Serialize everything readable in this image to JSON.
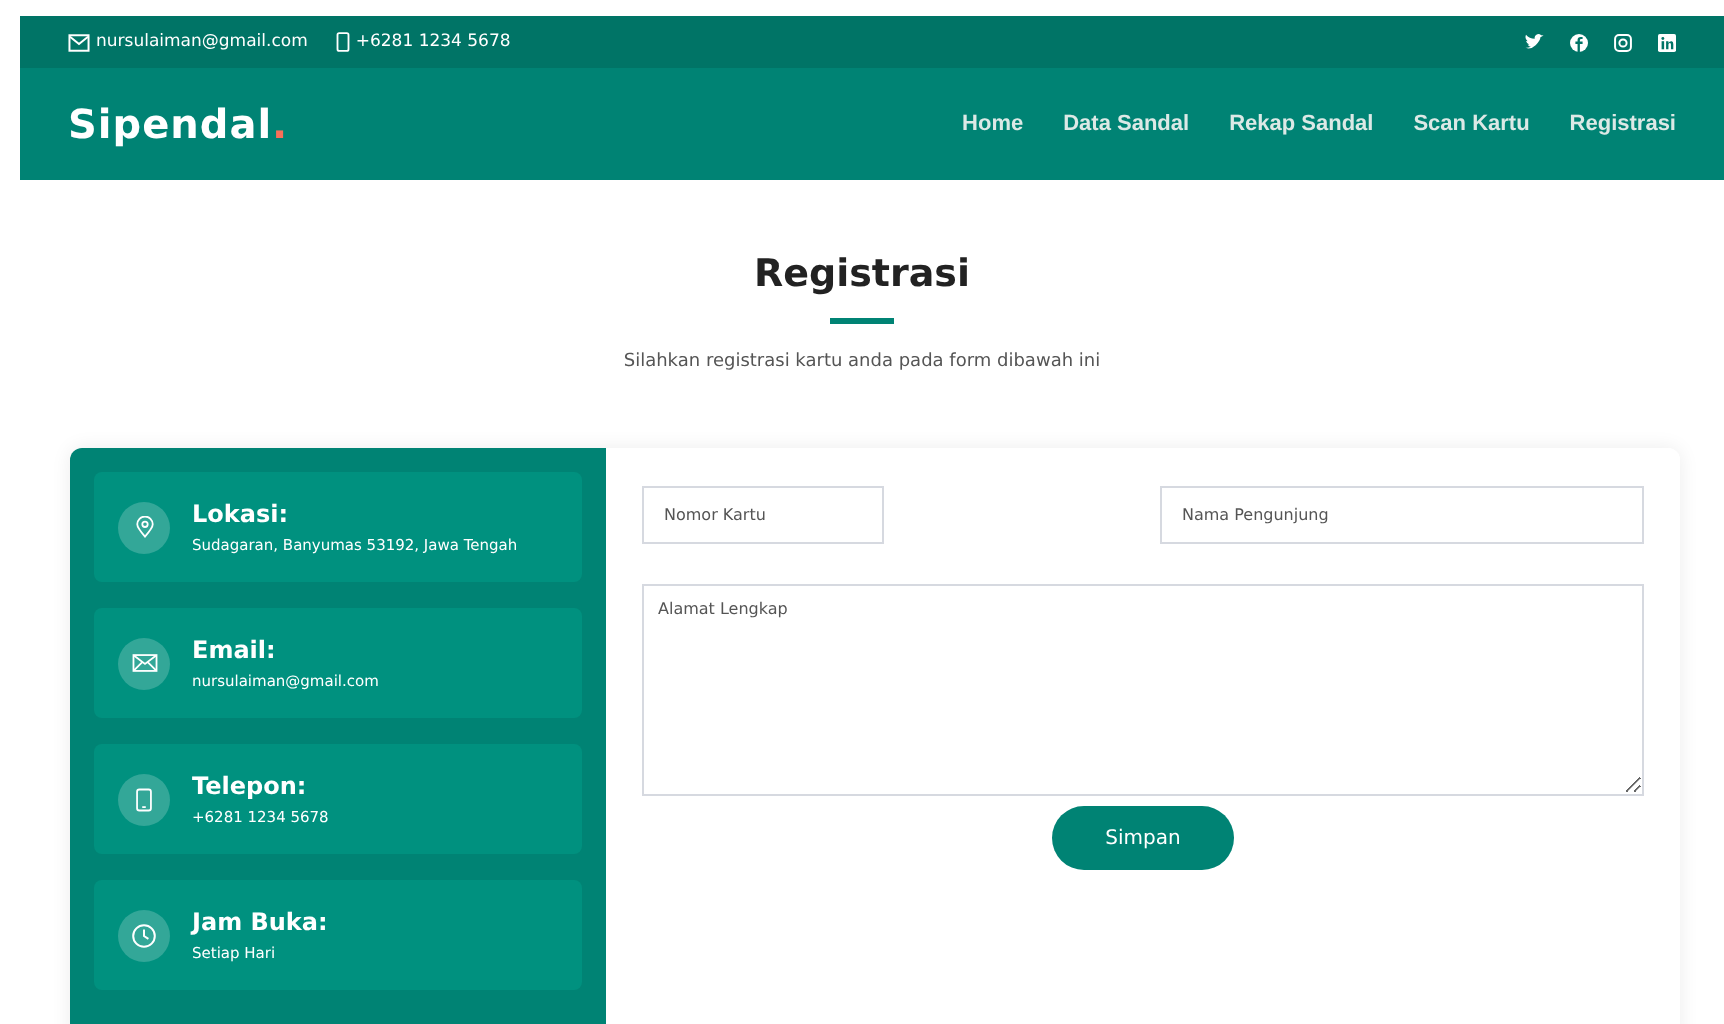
{
  "topbar": {
    "email": "nursulaiman@gmail.com",
    "phone": "+6281 1234 5678"
  },
  "header": {
    "logo": "Sipendal",
    "logo_dot": ".",
    "nav": [
      "Home",
      "Data Sandal",
      "Rekap Sandal",
      "Scan Kartu",
      "Registrasi"
    ]
  },
  "section": {
    "title": "Registrasi",
    "subtitle": "Silahkan registrasi kartu anda pada form dibawah ini"
  },
  "info": [
    {
      "kind": "location",
      "title": "Lokasi:",
      "text": "Sudagaran, Banyumas 53192, Jawa Tengah"
    },
    {
      "kind": "email",
      "title": "Email:",
      "text": "nursulaiman@gmail.com"
    },
    {
      "kind": "phone",
      "title": "Telepon:",
      "text": "+6281 1234 5678"
    },
    {
      "kind": "clock",
      "title": "Jam Buka:",
      "text": "Setiap Hari"
    }
  ],
  "form": {
    "card_number": {
      "placeholder": "Nomor Kartu"
    },
    "visitor_name": {
      "placeholder": "Nama Pengunjung"
    },
    "address": {
      "placeholder": "Alamat Lengkap"
    },
    "submit": "Simpan"
  }
}
